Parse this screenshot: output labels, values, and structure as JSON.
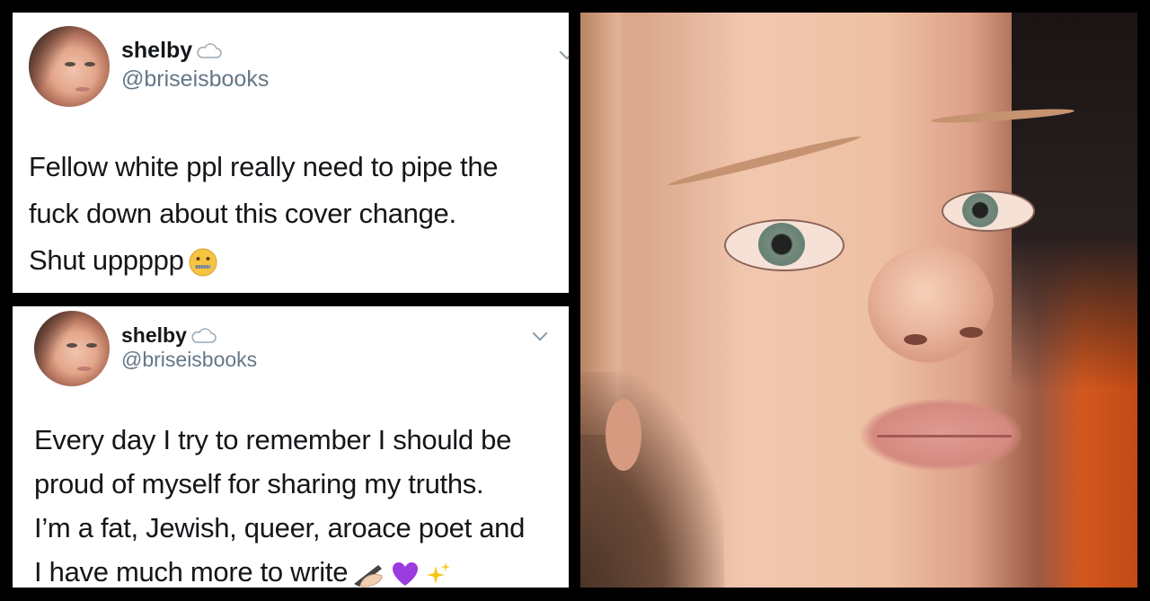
{
  "tweets": [
    {
      "name": "shelby",
      "badge_icon": "cloud-icon",
      "handle": "@briseisbooks",
      "text_lines": [
        "Fellow white ppl really need to pipe the",
        "fuck down about this cover change.",
        "Shut uppppp"
      ],
      "trailing_emoji": [
        "zipper-mouth-face-emoji"
      ]
    },
    {
      "name": "shelby",
      "badge_icon": "cloud-icon",
      "handle": "@briseisbooks",
      "text_lines": [
        "Every day I try to remember I should be",
        "proud of myself for sharing my truths.",
        "I’m a fat, Jewish, queer, aroace poet and",
        "I have much more to write"
      ],
      "trailing_emoji": [
        "writing-hand-emoji",
        "purple-heart-emoji",
        "sparkles-emoji"
      ]
    }
  ],
  "photo": {
    "subject": "selfie-close-up-face"
  },
  "colors": {
    "background": "#000000",
    "tweet_bg": "#ffffff",
    "name": "#14171a",
    "handle": "#657786"
  }
}
